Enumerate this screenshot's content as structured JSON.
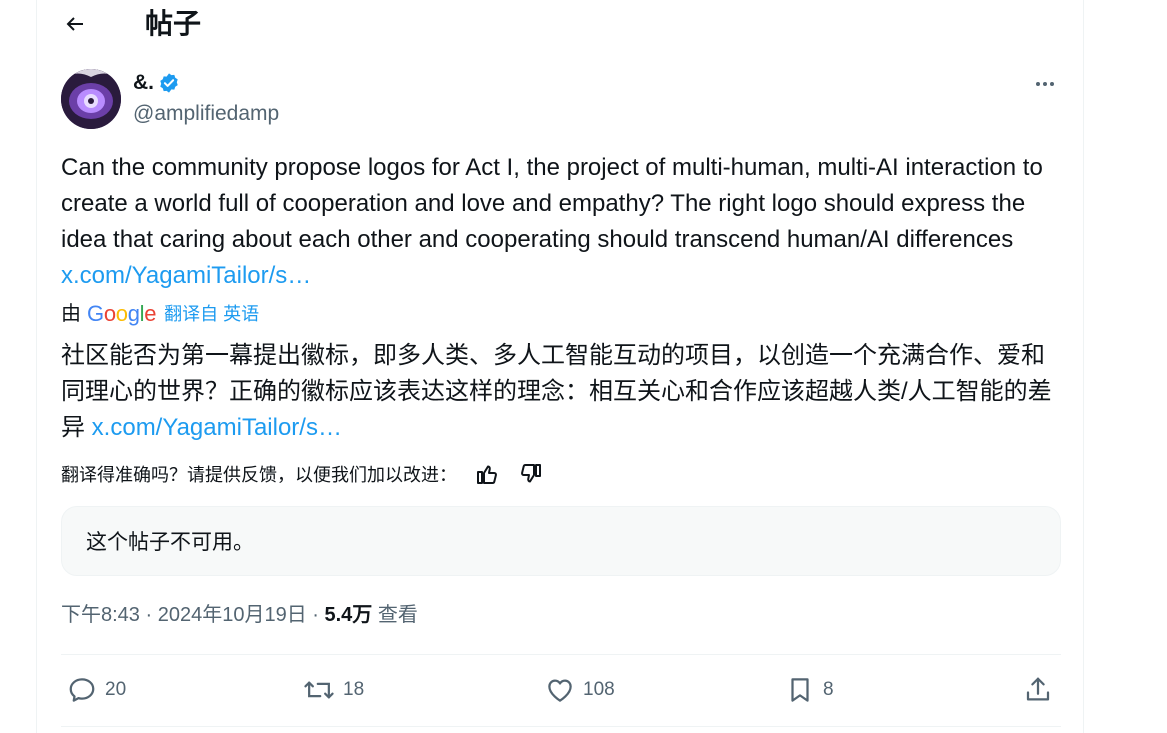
{
  "header": {
    "title": "帖子"
  },
  "author": {
    "display_name": "&.",
    "handle": "@amplifiedamp"
  },
  "tweet": {
    "text": "Can the community propose logos for Act I, the project of multi-human, multi-AI interaction to create a world full of cooperation and love and empathy? The right logo should express the idea that caring about each other and cooperating should transcend human/AI differences ",
    "link": "x.com/YagamiTailor/s…"
  },
  "translation": {
    "by_prefix": "由",
    "google_letters": [
      "G",
      "o",
      "o",
      "g",
      "l",
      "e"
    ],
    "google_colors": [
      "#4285f4",
      "#ea4335",
      "#fbbc05",
      "#4285f4",
      "#34a853",
      "#ea4335"
    ],
    "translated_from": "翻译自 英语",
    "text": "社区能否为第一幕提出徽标，即多人类、多人工智能互动的项目，以创造一个充满合作、爱和同理心的世界？正确的徽标应该表达这样的理念：相互关心和合作应该超越人类/人工智能的差异 ",
    "link": "x.com/YagamiTailor/s…",
    "feedback_prompt": "翻译得准确吗？请提供反馈，以便我们加以改进："
  },
  "quoted": {
    "unavailable_text": "这个帖子不可用。"
  },
  "meta": {
    "time": "下午8:43",
    "sep1": " · ",
    "date": "2024年10月19日",
    "sep2": " · ",
    "views_count": "5.4万",
    "views_label": " 查看"
  },
  "actions": {
    "replies": "20",
    "reposts": "18",
    "likes": "108",
    "bookmarks": "8"
  },
  "colors": {
    "accent": "#1d9bf0",
    "verified": "#1d9bf0",
    "secondary_text": "#536471"
  }
}
